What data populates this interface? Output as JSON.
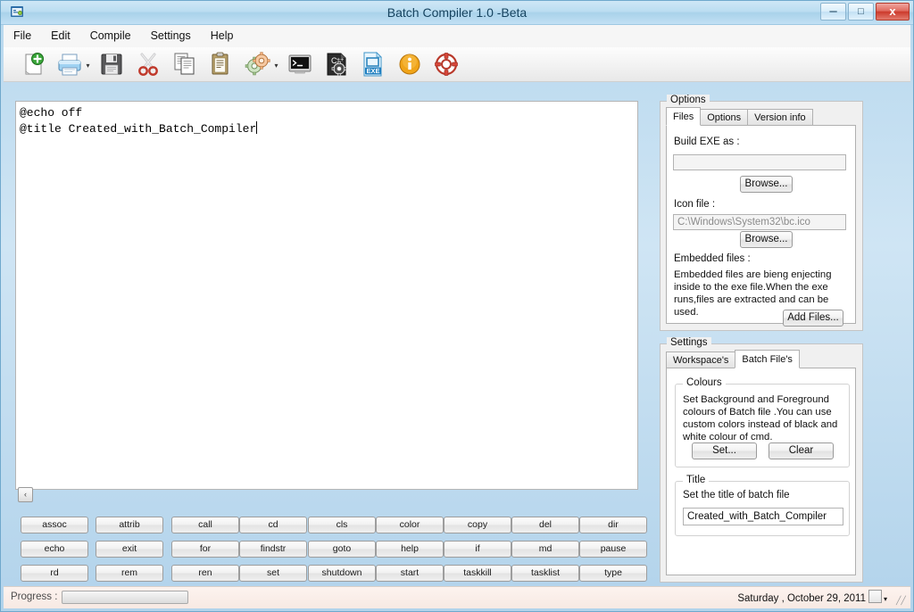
{
  "window": {
    "title": "Batch Compiler 1.0 -Beta",
    "app_icon": "app-logo-icon",
    "minimize": "–",
    "maximize": "□",
    "close": "x"
  },
  "menu": {
    "items": [
      {
        "label": "File"
      },
      {
        "label": "Edit"
      },
      {
        "label": "Compile"
      },
      {
        "label": "Settings"
      },
      {
        "label": "Help"
      }
    ]
  },
  "toolbar": {
    "buttons": [
      {
        "name": "new-file-icon",
        "tip": "New"
      },
      {
        "name": "print-icon",
        "tip": "Print"
      },
      {
        "name": "save-icon",
        "tip": "Save"
      },
      {
        "name": "cut-scissors-icon",
        "tip": "Cut"
      },
      {
        "name": "copy-icon",
        "tip": "Copy"
      },
      {
        "name": "paste-icon",
        "tip": "Paste"
      },
      {
        "name": "settings-gears-icon",
        "tip": "Options"
      },
      {
        "name": "console-icon",
        "tip": "Run in console"
      },
      {
        "name": "compile-icon",
        "tip": "Compile"
      },
      {
        "name": "build-exe-icon",
        "tip": "Build EXE"
      },
      {
        "name": "info-icon",
        "tip": "Info"
      },
      {
        "name": "help-lifering-icon",
        "tip": "Help"
      }
    ],
    "dropdown_caret": "▾"
  },
  "editor": {
    "lines": [
      "@echo off",
      "@title Created_with_Batch_Compiler"
    ],
    "scroll_left_glyph": "‹"
  },
  "commands": {
    "rows": [
      [
        "assoc",
        "attrib",
        "call",
        "cd",
        "cls",
        "color",
        "copy",
        "del",
        "dir"
      ],
      [
        "echo",
        "exit",
        "for",
        "findstr",
        "goto",
        "help",
        "if",
        "md",
        "pause"
      ],
      [
        "rd",
        "rem",
        "ren",
        "set",
        "shutdown",
        "start",
        "taskkill",
        "tasklist",
        "type"
      ]
    ]
  },
  "options_panel": {
    "caption": "Options",
    "tabs": [
      {
        "label": "Files",
        "active": true
      },
      {
        "label": "Options",
        "active": false
      },
      {
        "label": "Version info",
        "active": false
      }
    ],
    "build_exe_label": "Build EXE as :",
    "build_exe_value": "",
    "build_exe_placeholder": "",
    "browse_exe_label": "Browse...",
    "icon_file_label": "Icon file :",
    "icon_file_value": "C:\\Windows\\System32\\bc.ico",
    "browse_icon_label": "Browse...",
    "embedded_files_label": "Embedded files :",
    "embedded_files_desc": "Embedded files are bieng enjecting inside to the exe file.When the exe runs,files are extracted and can be used.",
    "add_files_label": "Add Files..."
  },
  "settings_panel": {
    "caption": "Settings",
    "tabs": [
      {
        "label": "Workspace's",
        "active": false
      },
      {
        "label": "Batch File's",
        "active": true
      }
    ],
    "colours": {
      "caption": "Colours",
      "description": "Set Background and Foreground colours of Batch file .You can use custom colors instead of black and white colour of cmd.",
      "set_label": "Set...",
      "clear_label": "Clear"
    },
    "title_group": {
      "caption": "Title",
      "description": "Set the title of batch file",
      "value": "Created_with_Batch_Compiler"
    }
  },
  "statusbar": {
    "progress_label": "Progress :",
    "progress_percent": 0,
    "date": "Saturday ,  October  29, 2011",
    "dropdown_caret": "▾",
    "resize_grip": "╱╱"
  },
  "colors": {
    "window_frame": "#6fa8cc",
    "titlebar_start": "#cfe7f6",
    "titlebar_end": "#b2d3eb",
    "close_button": "#cc3a2c",
    "panel_bg": "#f0f0f0",
    "editor_bg": "#ffffff",
    "statusbar_bg": "#fdf3ef"
  }
}
